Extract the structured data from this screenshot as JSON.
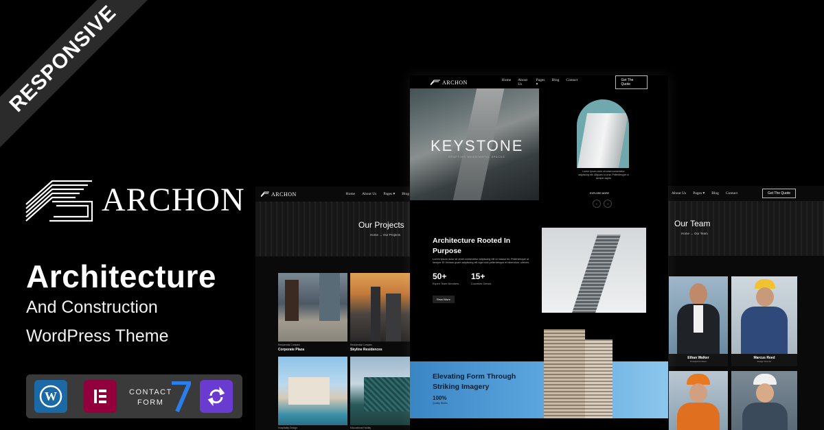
{
  "ribbon": "RESPONSIVE",
  "brand": {
    "name": "ARCHON"
  },
  "headline": "Architecture",
  "subheadline1": "And Construction",
  "subheadline2": "WordPress Theme",
  "plugins": [
    {
      "icon": "wordpress-icon",
      "color": "#1b6aa5"
    },
    {
      "icon": "elementor-icon",
      "color": "#92003b"
    },
    {
      "icon": "contact-form-icon",
      "line1": "CONTACT",
      "line2": "FORM",
      "color": "#2b7de9"
    },
    {
      "icon": "sync-icon",
      "color": "#6a3bd1"
    }
  ],
  "nav": {
    "logo": "ARCHON",
    "links": [
      "Home",
      "About Us",
      "Pages",
      "Blog",
      "Contact"
    ],
    "quote_btn": "Get The Quote"
  },
  "center": {
    "hero_title": "KEYSTONE",
    "hero_tagline": "CRAFTING MEANINGFUL SPACES",
    "hero_text": "Lorem ipsum dolor sit amet consectetur adipiscing elit. Aliquam in urna. Pellentesque ut semper aspen",
    "explore_btn": "EXPLORE MORE",
    "prev": "←",
    "next": "→",
    "about_title_1": "Architecture Rooted In",
    "about_title_2": "Purpose",
    "about_text": "Lorem ipsum dolor sit amet consectetur adipiscing elit ut massa mi. Pellentesque ut semper Et Veniam quam adipiscing elit eget sicit pellentesque et bibendum, ultrices.",
    "stat1_value": "50+",
    "stat1_label": "Expert Team Members",
    "stat2_value": "15+",
    "stat2_label": "Countries Served",
    "read_more": "Read More",
    "banner_title_1": "Elevating Form Through",
    "banner_title_2": "Striking Imagery",
    "banner_stat": "100%",
    "banner_stat_label": "Quality Works"
  },
  "projects": {
    "title": "Our Projects",
    "breadcrumb_home": "Home",
    "breadcrumb_sep": "→",
    "breadcrumb_current": "Our Projects",
    "cards": [
      {
        "category": "Residential Complex",
        "name": "Corporate Plaza"
      },
      {
        "category": "Residential Complex",
        "name": "Skyline Residences"
      },
      {
        "category": "Hospitality Design",
        "name": ""
      },
      {
        "category": "Educational Facility",
        "name": ""
      }
    ]
  },
  "team": {
    "title": "Our Team",
    "breadcrumb_home": "Home",
    "breadcrumb_sep": "→",
    "breadcrumb_current": "Our Team",
    "members": [
      {
        "name": "Ethan Walker",
        "role": "Principal Architect"
      },
      {
        "name": "Marcus Reed",
        "role": "Design Director"
      }
    ]
  }
}
